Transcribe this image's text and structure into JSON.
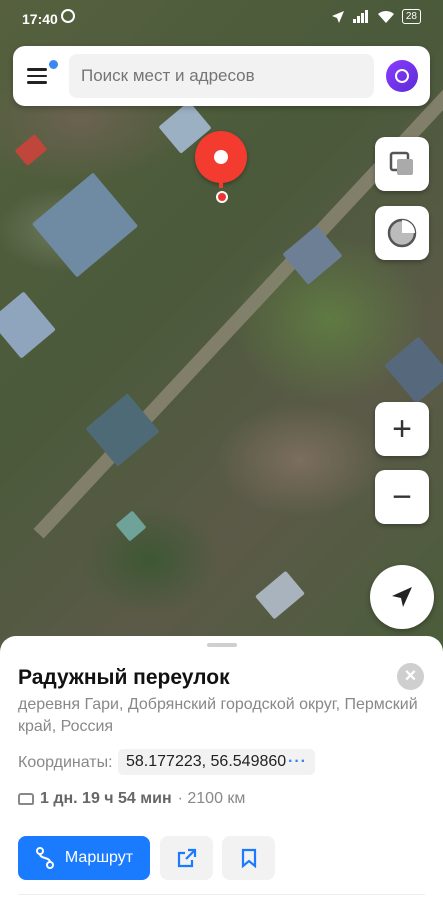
{
  "status_bar": {
    "time": "17:40",
    "battery": "28"
  },
  "search": {
    "placeholder": "Поиск мест и адресов"
  },
  "map": {
    "zoom_in": "+",
    "zoom_out": "−"
  },
  "place": {
    "title": "Радужный переулок",
    "address": "деревня Гари, Добрянский городской округ, Пермский край, Россия",
    "coordinates_label": "Координаты:",
    "coordinates": "58.177223, 56.549860",
    "coordinates_more": "···",
    "travel_time": "1 дн. 19 ч 54 мин",
    "distance": "· 2100 км"
  },
  "actions": {
    "route_label": "Маршрут"
  },
  "colors": {
    "accent": "#1a7bff",
    "pin": "#f33b2f",
    "assistant": "#8a3cff"
  },
  "icons": [
    "menu-icon",
    "notification-dot-icon",
    "alice-icon",
    "layers-icon",
    "traffic-icon",
    "plus-icon",
    "minus-icon",
    "location-arrow-icon",
    "close-icon",
    "car-icon",
    "route-icon",
    "share-icon",
    "bookmark-icon"
  ]
}
